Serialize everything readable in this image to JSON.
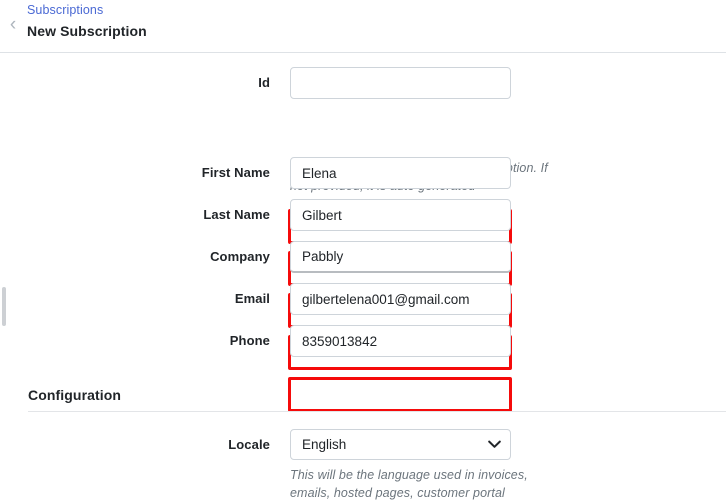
{
  "header": {
    "back_icon": "chevron-left-icon",
    "breadcrumb": "Subscriptions",
    "title": "New Subscription"
  },
  "sidebar": {
    "handle_label": "collapsed-sidebar-handle"
  },
  "form": {
    "fields": [
      {
        "key": "id",
        "label": "Id",
        "value": "",
        "placeholder": "",
        "highlighted": false,
        "helper": "Id used to uniquely identify the subscription. If not provided, it is auto generated"
      },
      {
        "key": "first_name",
        "label": "First Name",
        "value": "Elena",
        "placeholder": "",
        "highlighted": true,
        "helper": ""
      },
      {
        "key": "last_name",
        "label": "Last Name",
        "value": "Gilbert",
        "placeholder": "",
        "highlighted": true,
        "helper": ""
      },
      {
        "key": "company",
        "label": "Company",
        "value": "Pabbly",
        "placeholder": "",
        "highlighted": true,
        "helper": ""
      },
      {
        "key": "email",
        "label": "Email",
        "value": "gilbertelena001@gmail.com",
        "placeholder": "",
        "highlighted": true,
        "helper": ""
      },
      {
        "key": "phone",
        "label": "Phone",
        "value": "8359013842",
        "placeholder": "",
        "highlighted": true,
        "helper": ""
      }
    ]
  },
  "configuration": {
    "section_title": "Configuration",
    "locale": {
      "label": "Locale",
      "selected": "English",
      "options": [
        "English"
      ],
      "chevron_icon": "chevron-down-icon",
      "helper": "This will be the language used in invoices, emails, hosted pages, customer portal"
    }
  },
  "colors": {
    "link": "#4a69d4",
    "highlight": "#f50b0b",
    "text": "#212529",
    "muted": "#6c757d",
    "border": "#ced4da"
  }
}
